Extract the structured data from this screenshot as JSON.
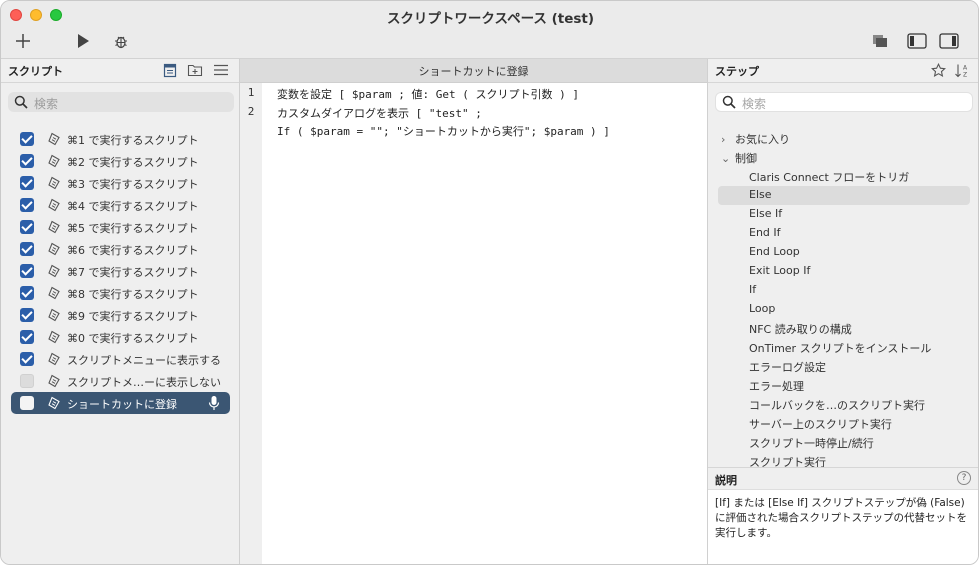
{
  "window": {
    "title": "スクリプトワークスペース (test)"
  },
  "scripts_panel": {
    "title": "スクリプト",
    "search_placeholder": "検索",
    "items": [
      {
        "label": "⌘1 で実行するスクリプト",
        "checked": true
      },
      {
        "label": "⌘2 で実行するスクリプト",
        "checked": true
      },
      {
        "label": "⌘3 で実行するスクリプト",
        "checked": true
      },
      {
        "label": "⌘4 で実行するスクリプト",
        "checked": true
      },
      {
        "label": "⌘5 で実行するスクリプト",
        "checked": true
      },
      {
        "label": "⌘6 で実行するスクリプト",
        "checked": true
      },
      {
        "label": "⌘7 で実行するスクリプト",
        "checked": true
      },
      {
        "label": "⌘8 で実行するスクリプト",
        "checked": true
      },
      {
        "label": "⌘9 で実行するスクリプト",
        "checked": true
      },
      {
        "label": "⌘0 で実行するスクリプト",
        "checked": true
      },
      {
        "label": "スクリプトメニューに表示する",
        "checked": true
      },
      {
        "label": "スクリプトメ…ーに表示しない",
        "checked": false
      },
      {
        "label": "ショートカットに登録",
        "checked": false,
        "selected": true
      }
    ]
  },
  "editor": {
    "tab_title": "ショートカットに登録",
    "lines": [
      {
        "num": "1",
        "text": "変数を設定 [ $param ; 値: Get ( スクリプト引数 ) ]"
      },
      {
        "num": "2",
        "text": "カスタムダイアログを表示 [ \"test\" ;"
      },
      {
        "num": "",
        "text": "If ( $param = \"\"; \"ショートカットから実行\"; $param ) ]"
      }
    ]
  },
  "steps_panel": {
    "title": "ステップ",
    "search_placeholder": "検索",
    "categories": [
      {
        "label": "お気に入り",
        "expanded": false
      },
      {
        "label": "制御",
        "expanded": true
      }
    ],
    "steps": [
      "Claris Connect フローをトリガ",
      "Else",
      "Else If",
      "End If",
      "End Loop",
      "Exit Loop If",
      "If",
      "Loop",
      "NFC 読み取りの構成",
      "OnTimer スクリプトをインストール",
      "エラーログ設定",
      "エラー処理",
      "コールバックを…のスクリプト実行",
      "サーバー上のスクリプト実行",
      "スクリプト一時停止/続行",
      "スクリプト実行"
    ],
    "highlighted_step": "Else"
  },
  "description": {
    "title": "説明",
    "text": "[If] または [Else If] スクリプトステップが偽 (False) に評価された場合スクリプトステップの代替セットを実行します。"
  },
  "colors": {
    "selection": "#3b5673",
    "checkbox": "#2b5ea9"
  }
}
